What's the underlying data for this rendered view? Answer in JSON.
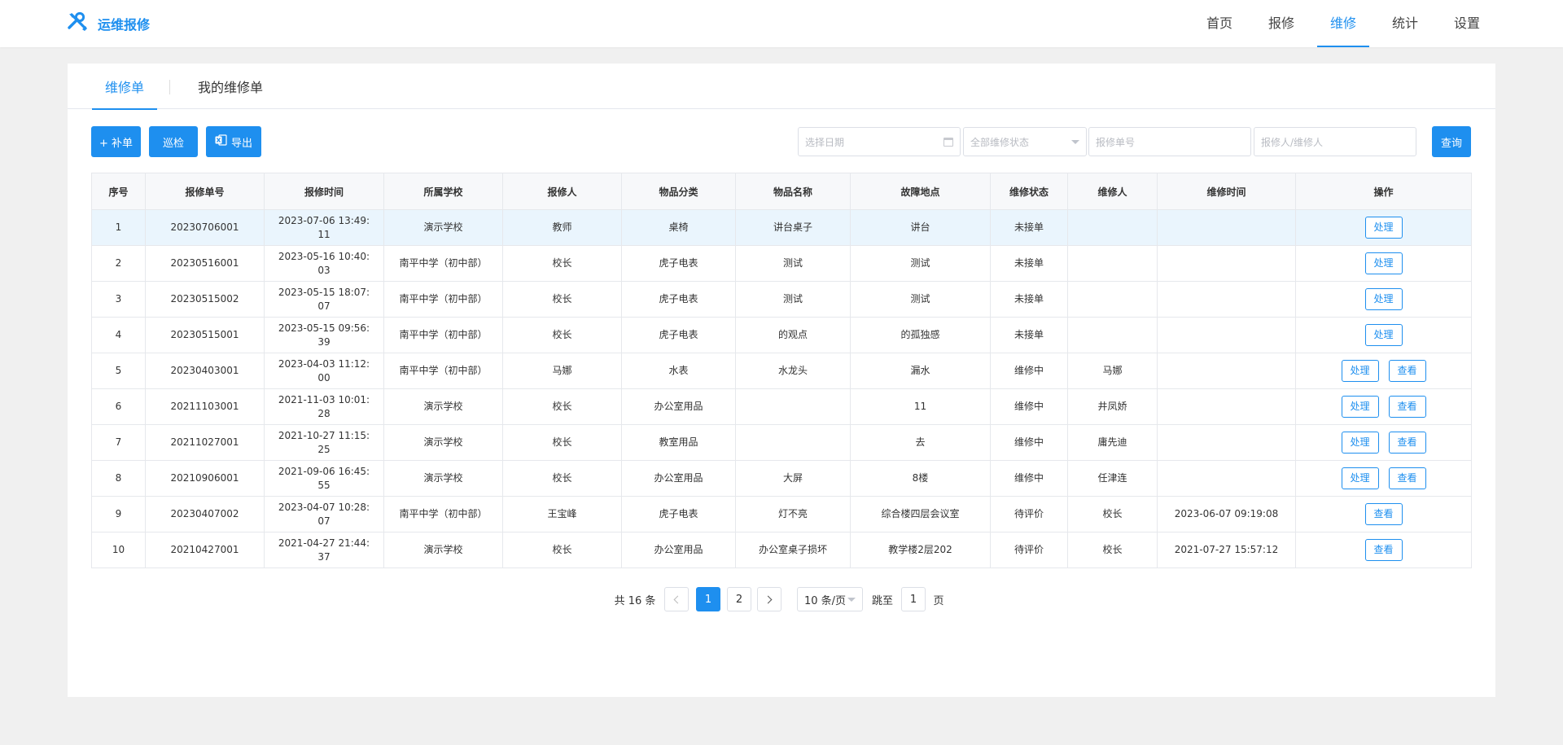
{
  "app": {
    "title": "运维报修",
    "logo_icon": "tools-icon",
    "accent": "#1e8fef"
  },
  "nav": [
    {
      "label": "首页",
      "active": false
    },
    {
      "label": "报修",
      "active": false
    },
    {
      "label": "维修",
      "active": true
    },
    {
      "label": "统计",
      "active": false
    },
    {
      "label": "设置",
      "active": false
    }
  ],
  "tabs": [
    {
      "label": "维修单",
      "active": true
    },
    {
      "label": "我的维修单",
      "active": false
    }
  ],
  "toolbar": {
    "add_label": "+ 补单",
    "patrol_label": "巡检",
    "export_label": "导出",
    "date_placeholder": "选择日期",
    "status_placeholder": "全部维修状态",
    "order_no_placeholder": "报修单号",
    "person_placeholder": "报修人/维修人",
    "query_label": "查询"
  },
  "table": {
    "columns": [
      "序号",
      "报修单号",
      "报修时间",
      "所属学校",
      "报修人",
      "物品分类",
      "物品名称",
      "故障地点",
      "维修状态",
      "维修人",
      "维修时间",
      "操作"
    ],
    "rows": [
      {
        "idx": "1",
        "order_no": "20230706001",
        "time_l1": "2023-07-06 13:49:",
        "time_l2": "11",
        "school": "演示学校",
        "reporter": "教师",
        "category": "桌椅",
        "item": "讲台桌子",
        "location": "讲台",
        "status": "未接单",
        "repairer": "",
        "repair_time": "",
        "actions": [
          "处理"
        ]
      },
      {
        "idx": "2",
        "order_no": "20230516001",
        "time_l1": "2023-05-16 10:40:",
        "time_l2": "03",
        "school": "南平中学（初中部）",
        "reporter": "校长",
        "category": "虎子电表",
        "item": "测试",
        "location": "测试",
        "status": "未接单",
        "repairer": "",
        "repair_time": "",
        "actions": [
          "处理"
        ]
      },
      {
        "idx": "3",
        "order_no": "20230515002",
        "time_l1": "2023-05-15 18:07:",
        "time_l2": "07",
        "school": "南平中学（初中部）",
        "reporter": "校长",
        "category": "虎子电表",
        "item": "测试",
        "location": "测试",
        "status": "未接单",
        "repairer": "",
        "repair_time": "",
        "actions": [
          "处理"
        ]
      },
      {
        "idx": "4",
        "order_no": "20230515001",
        "time_l1": "2023-05-15 09:56:",
        "time_l2": "39",
        "school": "南平中学（初中部）",
        "reporter": "校长",
        "category": "虎子电表",
        "item": "的观点",
        "location": "的孤独感",
        "status": "未接单",
        "repairer": "",
        "repair_time": "",
        "actions": [
          "处理"
        ]
      },
      {
        "idx": "5",
        "order_no": "20230403001",
        "time_l1": "2023-04-03 11:12:",
        "time_l2": "00",
        "school": "南平中学（初中部）",
        "reporter": "马娜",
        "category": "水表",
        "item": "水龙头",
        "location": "漏水",
        "status": "维修中",
        "repairer": "马娜",
        "repair_time": "",
        "actions": [
          "处理",
          "查看"
        ]
      },
      {
        "idx": "6",
        "order_no": "20211103001",
        "time_l1": "2021-11-03 10:01:",
        "time_l2": "28",
        "school": "演示学校",
        "reporter": "校长",
        "category": "办公室用品",
        "item": "",
        "location": "11",
        "status": "维修中",
        "repairer": "井凤娇",
        "repair_time": "",
        "actions": [
          "处理",
          "查看"
        ]
      },
      {
        "idx": "7",
        "order_no": "20211027001",
        "time_l1": "2021-10-27 11:15:",
        "time_l2": "25",
        "school": "演示学校",
        "reporter": "校长",
        "category": "教室用品",
        "item": "",
        "location": "去",
        "status": "维修中",
        "repairer": "庸先迪",
        "repair_time": "",
        "actions": [
          "处理",
          "查看"
        ]
      },
      {
        "idx": "8",
        "order_no": "20210906001",
        "time_l1": "2021-09-06 16:45:",
        "time_l2": "55",
        "school": "演示学校",
        "reporter": "校长",
        "category": "办公室用品",
        "item": "大屏",
        "location": "8楼",
        "status": "维修中",
        "repairer": "任津连",
        "repair_time": "",
        "actions": [
          "处理",
          "查看"
        ]
      },
      {
        "idx": "9",
        "order_no": "20230407002",
        "time_l1": "2023-04-07 10:28:",
        "time_l2": "07",
        "school": "南平中学（初中部）",
        "reporter": "王宝峰",
        "category": "虎子电表",
        "item": "灯不亮",
        "location": "综合楼四层会议室",
        "status": "待评价",
        "repairer": "校长",
        "repair_time": "2023-06-07 09:19:08",
        "actions": [
          "查看"
        ]
      },
      {
        "idx": "10",
        "order_no": "20210427001",
        "time_l1": "2021-04-27 21:44:",
        "time_l2": "37",
        "school": "演示学校",
        "reporter": "校长",
        "category": "办公室用品",
        "item": "办公室桌子损坏",
        "location": "教学楼2层202",
        "status": "待评价",
        "repairer": "校长",
        "repair_time": "2021-07-27 15:57:12",
        "actions": [
          "查看"
        ]
      }
    ],
    "highlight_color": "#eaf5fd",
    "red_order_color": "#e94444"
  },
  "pagination": {
    "total_label": "共 16 条",
    "pages": [
      "1",
      "2"
    ],
    "current_page": "1",
    "page_size_label": "10 条/页",
    "goto_label": "跳至",
    "goto_value": "1",
    "page_suffix": "页"
  }
}
